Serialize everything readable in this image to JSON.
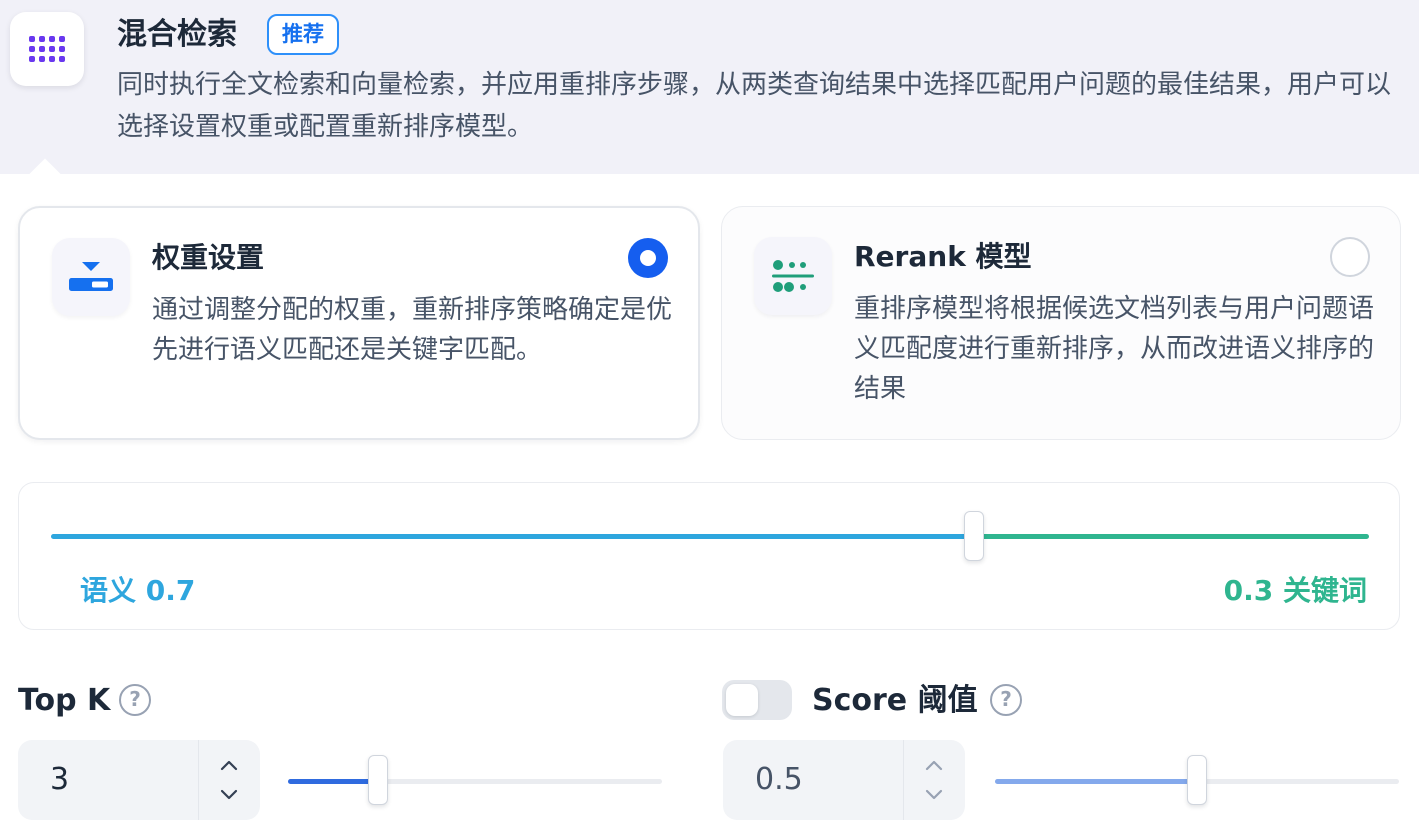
{
  "header": {
    "title": "混合检索",
    "badge": "推荐",
    "description": "同时执行全文检索和向量检索，并应用重排序步骤，从两类查询结果中选择匹配用户问题的最佳结果，用户可以选择设置权重或配置重新排序模型。",
    "icon": "dot-grid-icon",
    "icon_color": "#6938ef"
  },
  "options": {
    "weight": {
      "title": "权重设置",
      "description": "通过调整分配的权重，重新排序策略确定是优先进行语义匹配还是关键字匹配。",
      "selected": true,
      "icon": "weight-sliders-icon"
    },
    "rerank": {
      "title": "Rerank 模型",
      "description": "重排序模型将根据候选文档列表与用户问题语义匹配度进行重新排序，从而改进语义排序的结果",
      "selected": false,
      "icon": "rerank-dots-icon"
    }
  },
  "weight_slider": {
    "semantic_label": "语义 0.7",
    "keyword_label": "0.3 关键词",
    "semantic_value": 0.7,
    "keyword_value": 0.3,
    "semantic_color": "#2ea6de",
    "keyword_color": "#2fb58f"
  },
  "top_k": {
    "label": "Top K",
    "value": "3",
    "slider_fraction": 0.24,
    "fill_color": "#2f6bdf"
  },
  "score_threshold": {
    "label": "Score 阈值",
    "enabled": false,
    "value": "0.5",
    "slider_fraction": 0.5,
    "fill_color": "#84a9ec"
  },
  "help_glyph": "?"
}
